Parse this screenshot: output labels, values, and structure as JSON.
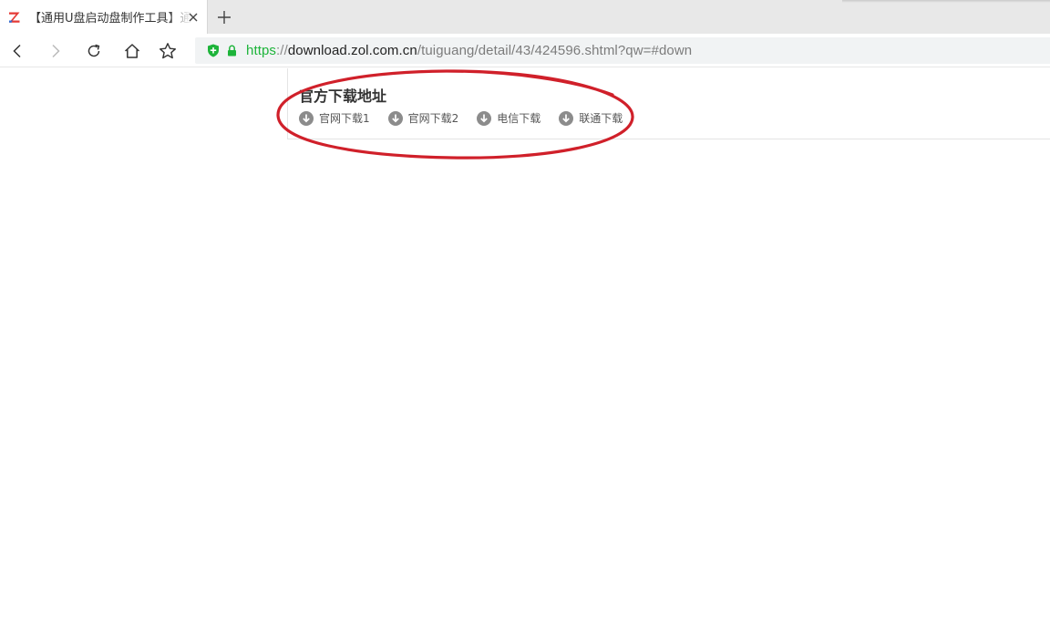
{
  "tab": {
    "title": "【通用U盘启动盘制作工具】通用U盘启动盘制作工具"
  },
  "address_bar": {
    "scheme": "https",
    "separator": "://",
    "host": "download.zol.com.cn",
    "path": "/tuiguang/detail/43/424596.shtml?qw=#down"
  },
  "download_section": {
    "title": "官方下载地址",
    "links": [
      {
        "label": "官网下载1",
        "icon": "download-circle-icon"
      },
      {
        "label": "官网下载2",
        "icon": "download-circle-icon"
      },
      {
        "label": "电信下载",
        "icon": "download-circle-icon"
      },
      {
        "label": "联通下载",
        "icon": "download-circle-icon"
      }
    ]
  },
  "colors": {
    "annotation_ellipse": "#d0202a",
    "https_green": "#1db43a",
    "icon_gray": "#8c8c8c",
    "favicon_red": "#e53935",
    "favicon_blue": "#2f6fd6"
  }
}
